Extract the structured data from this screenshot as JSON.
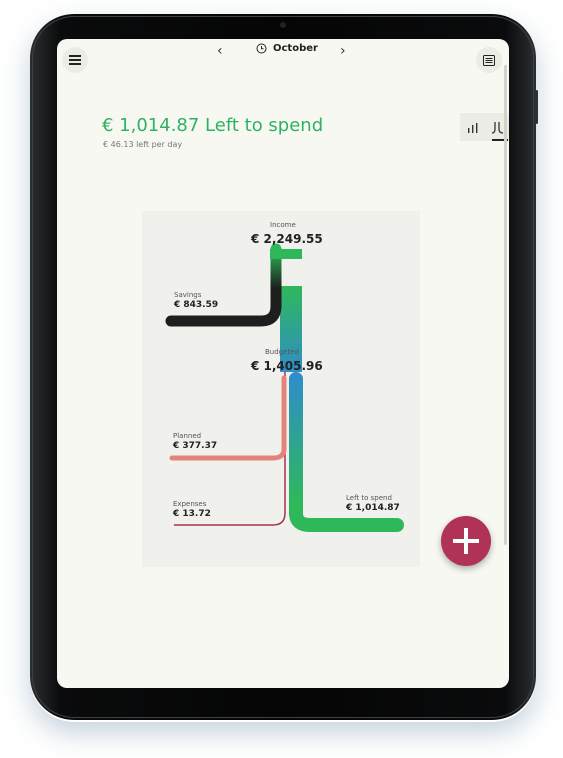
{
  "header": {
    "prev_arrow": "‹",
    "next_arrow": "›",
    "month": "October",
    "menu_icon": "hamburger-menu-icon",
    "clock_icon": "clock-icon",
    "list_icon": "list-view-icon"
  },
  "summary": {
    "headline": "€ 1,014.87 Left to spend",
    "per_day": "€ 46.13 left per day"
  },
  "view_toggle": {
    "bar_icon": "bar-chart-icon",
    "flow_icon": "flow-chart-icon",
    "selected": "flow"
  },
  "chart_data": {
    "type": "sankey",
    "nodes": {
      "income": {
        "label": "Income",
        "value": "€ 2,249.55"
      },
      "savings": {
        "label": "Savings",
        "value": "€ 843.59"
      },
      "budgeted": {
        "label": "Budgeted",
        "value": "€ 1,405.96"
      },
      "planned": {
        "label": "Planned",
        "value": "€ 377.37"
      },
      "expenses": {
        "label": "Expenses",
        "value": "€ 13.72"
      },
      "left": {
        "label": "Left to spend",
        "value": "€ 1,014.87"
      }
    },
    "flows": [
      {
        "from": "Income",
        "to": "Savings",
        "amount": 843.59
      },
      {
        "from": "Income",
        "to": "Budgeted",
        "amount": 1405.96
      },
      {
        "from": "Budgeted",
        "to": "Planned",
        "amount": 377.37
      },
      {
        "from": "Budgeted",
        "to": "Expenses",
        "amount": 13.72
      },
      {
        "from": "Budgeted",
        "to": "Left to spend",
        "amount": 1014.87
      }
    ],
    "colors": {
      "income": "#2fb85a",
      "savings": "#1e1e1e",
      "budgeted": "#2f8ec8",
      "planned": "#e5837a",
      "expenses": "#a83050",
      "left": "#2fb85a"
    }
  },
  "fab": {
    "icon": "plus-icon",
    "color": "#b03357"
  }
}
